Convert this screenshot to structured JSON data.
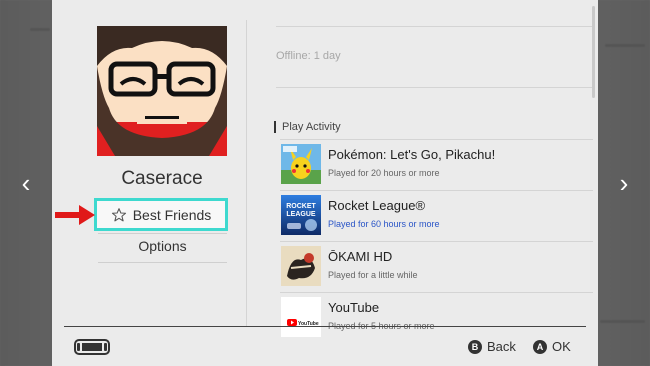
{
  "profile": {
    "username": "Caserace",
    "best_friends_label": "Best Friends",
    "options_label": "Options",
    "offline_status": "Offline: 1 day"
  },
  "play_activity": {
    "heading": "Play Activity",
    "games": [
      {
        "title": "Pokémon: Let's Go, Pikachu!",
        "played": "Played for 20 hours or more",
        "played_color": "#666666"
      },
      {
        "title": "Rocket League®",
        "played": "Played for 60 hours or more",
        "played_color": "#2a55c7"
      },
      {
        "title": "ŌKAMI HD",
        "played": "Played for a little while",
        "played_color": "#666666"
      },
      {
        "title": "YouTube",
        "played": "Played for 5 hours or more",
        "played_color": "#666666"
      }
    ]
  },
  "footer": {
    "back_button_glyph": "B",
    "back_label": "Back",
    "ok_button_glyph": "A",
    "ok_label": "OK"
  },
  "nav": {
    "left_arrow": "‹",
    "right_arrow": "›"
  },
  "colors": {
    "highlight": "#3ed9cf",
    "annotation_arrow": "#e01919",
    "panel_bg": "#ebebeb"
  },
  "icons": [
    "chevron-left-icon",
    "chevron-right-icon",
    "star-icon",
    "console-icon",
    "b-button-icon",
    "a-button-icon",
    "red-arrow-annotation"
  ]
}
